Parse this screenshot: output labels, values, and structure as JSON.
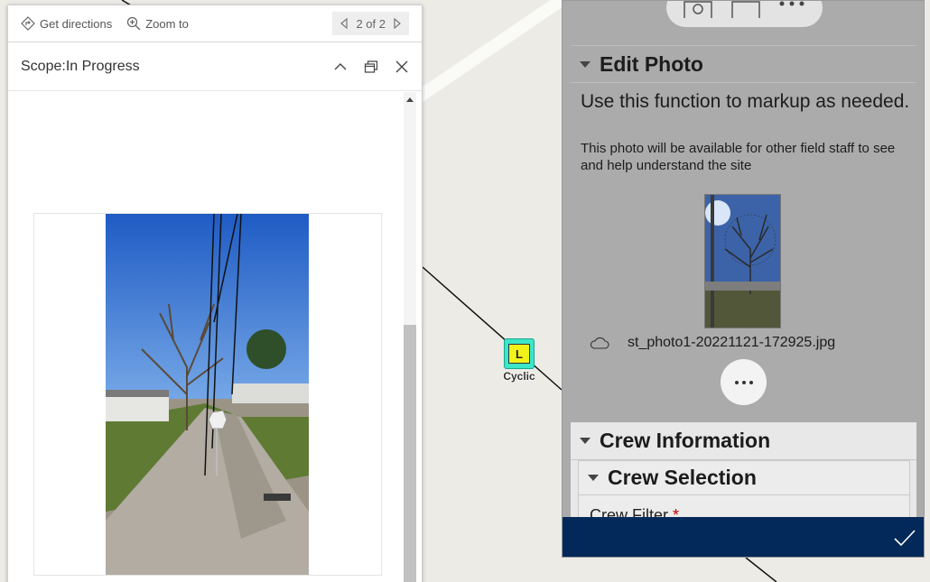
{
  "popup": {
    "toolbar": {
      "directions_label": "Get directions",
      "zoom_label": "Zoom to",
      "pager_text": "2 of 2"
    },
    "title": "Scope:In Progress"
  },
  "map": {
    "marker_letter": "L",
    "marker_label": "Cyclic"
  },
  "form": {
    "edit_photo": {
      "title": "Edit Photo",
      "description": "Use this function to markup as needed.",
      "help": "This photo will be available for other field staff to see and help understand the site",
      "filename": "st_photo1-20221121-172925.jpg"
    },
    "crew_information": {
      "title": "Crew Information",
      "crew_selection_title": "Crew Selection",
      "crew_filter_label": "Crew Filter",
      "required_marker": "*"
    }
  },
  "colors": {
    "footer": "#02295a",
    "form_bg": "#ababab",
    "marker": "#3ce6c8",
    "marker_inner": "#f2f21a"
  }
}
